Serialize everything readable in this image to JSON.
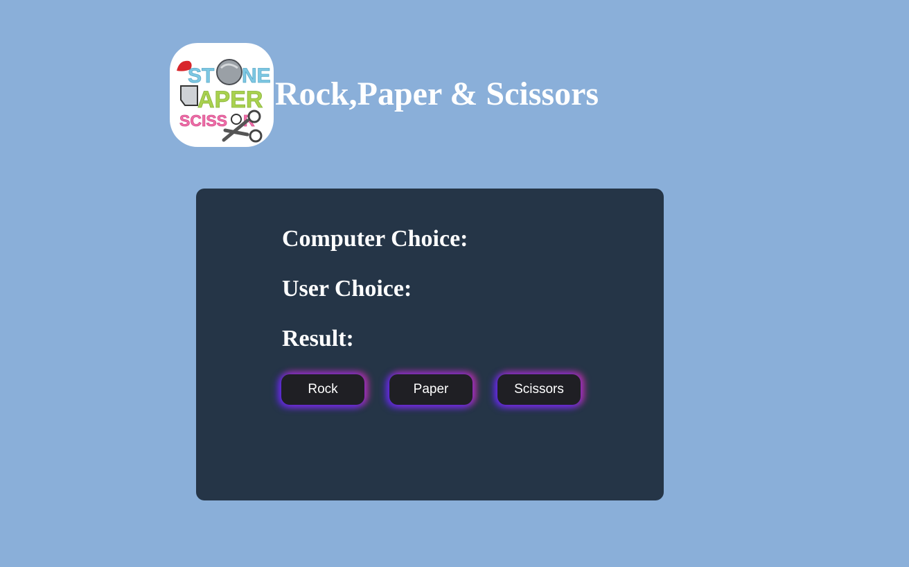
{
  "header": {
    "title": "Rock,Paper & Scissors",
    "logo_text": [
      "STONE",
      "PAPER",
      "SCISSOR"
    ]
  },
  "game": {
    "computer_choice_label": "Computer Choice:",
    "computer_choice_value": "",
    "user_choice_label": "User Choice:",
    "user_choice_value": "",
    "result_label": "Result:",
    "result_value": ""
  },
  "buttons": {
    "rock": "Rock",
    "paper": "Paper",
    "scissors": "Scissors"
  },
  "colors": {
    "background": "#8aafd9",
    "panel": "#253547",
    "button": "#1f1f24",
    "glow_blue": "#5a28ff",
    "glow_pink": "#e132aa"
  }
}
